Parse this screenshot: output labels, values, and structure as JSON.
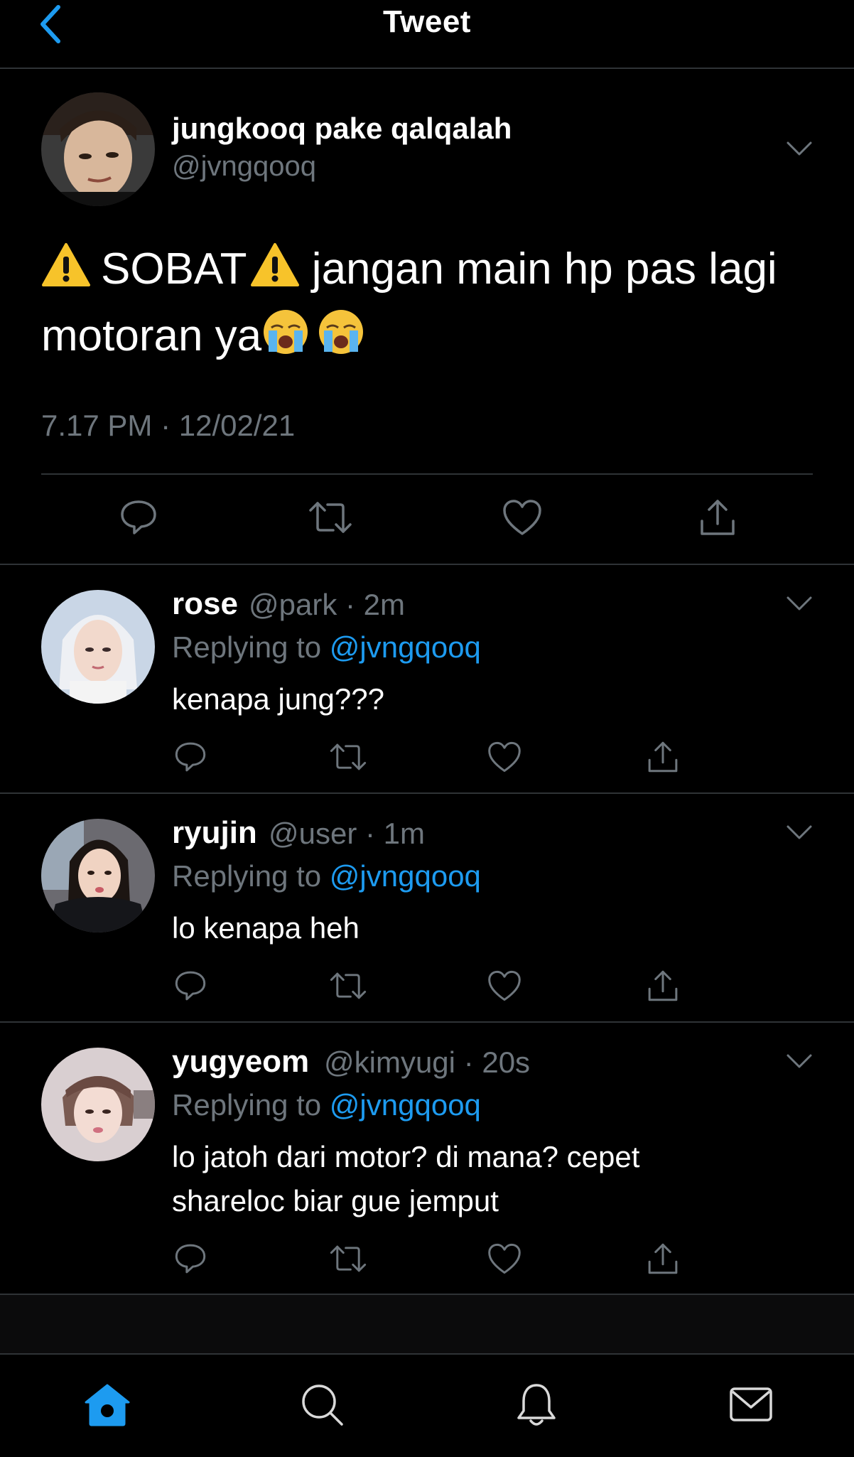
{
  "header": {
    "title": "Tweet"
  },
  "main_tweet": {
    "display_name": "jungkooq pake qalqalah",
    "handle": "@jvngqooq",
    "text_part1": "SOBAT",
    "text_part2": "jangan main hp pas lagi",
    "text_part3": "motoran ya",
    "timestamp": "7.17 PM · 12/02/21"
  },
  "replies": [
    {
      "display_name": "rose",
      "handle": "@park",
      "time": "· 2m",
      "replying_label": "Replying to",
      "mention": "@jvngqooq",
      "text": "kenapa jung???"
    },
    {
      "display_name": "ryujin",
      "handle": "@user",
      "time": "· 1m",
      "replying_label": "Replying to",
      "mention": "@jvngqooq",
      "text": "lo kenapa heh"
    },
    {
      "display_name": "yugyeom",
      "handle": "@kimyugi",
      "time": "· 20s",
      "replying_label": "Replying to",
      "mention": "@jvngqooq",
      "text_line1": "lo jatoh dari motor? di mana? cepet",
      "text_line2": "shareloc biar gue jemput"
    }
  ],
  "colors": {
    "accent": "#1d9bf0",
    "muted": "#6e767d",
    "divider": "#2f3336"
  },
  "icons": [
    "chevron-left-icon",
    "chevron-down-icon",
    "reply-icon",
    "retweet-icon",
    "like-icon",
    "share-icon",
    "home-icon",
    "search-icon",
    "bell-icon",
    "mail-icon",
    "warning-emoji",
    "crying-emoji"
  ]
}
